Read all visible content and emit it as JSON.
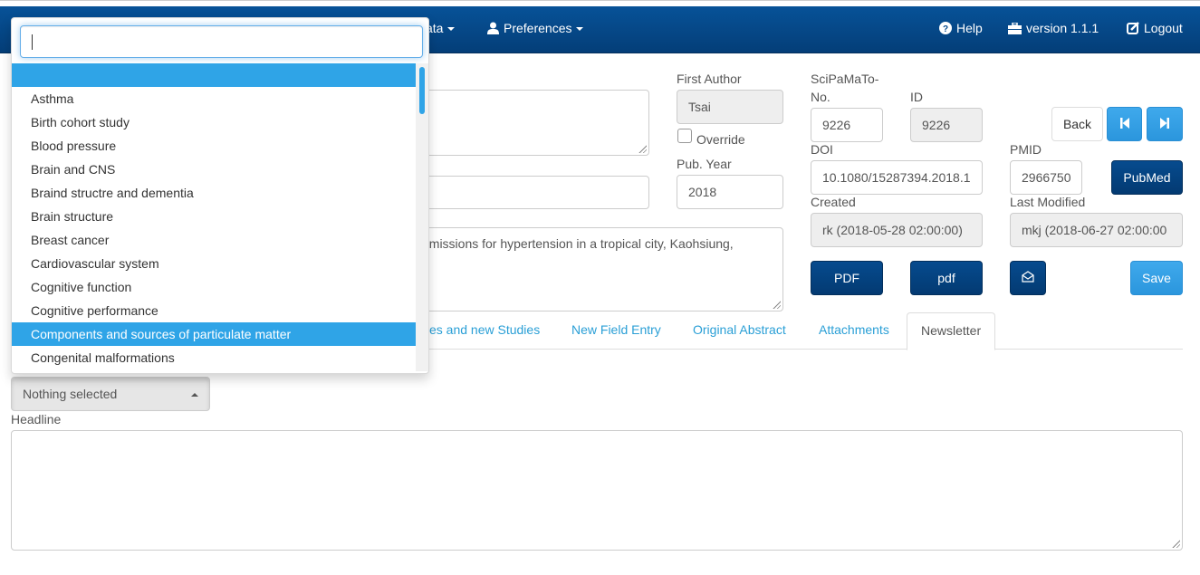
{
  "navbar": {
    "partial_menu": "ata",
    "preferences": "Preferences",
    "help": "Help",
    "version": "version 1.1.1",
    "logout": "Logout",
    "icons": {
      "preferences": "user-icon",
      "help": "question-circle-icon",
      "version": "briefcase-icon",
      "logout": "edit-square-icon"
    }
  },
  "form": {
    "first_author": {
      "label": "First Author",
      "value": "Tsai"
    },
    "override": {
      "label": "Override",
      "checked": false
    },
    "pub_year": {
      "label": "Pub. Year",
      "value": "2018"
    },
    "scipamato_no": {
      "label_line1": "SciPaMaTo-",
      "label_line2": "No.",
      "value": "9226"
    },
    "id": {
      "label": "ID",
      "value": "9226"
    },
    "doi": {
      "label": "DOI",
      "value": "10.1080/15287394.2018.1"
    },
    "pmid": {
      "label": "PMID",
      "value": "2966750"
    },
    "created": {
      "label": "Created",
      "value": "rk (2018-05-28 02:00:00)"
    },
    "last_modified": {
      "label": "Last Modified",
      "value": "mkj (2018-06-27 02:00:00"
    },
    "title_partial": "dmissions for hypertension in a tropical city, Kaohsiung,"
  },
  "buttons": {
    "back": "Back",
    "pubmed": "PubMed",
    "pdf_upper": "PDF",
    "pdf_lower": "pdf",
    "save": "Save",
    "prev_icon": "step-backward-icon",
    "next_icon": "step-forward-icon",
    "mail_icon": "envelope-open-icon"
  },
  "tabs": [
    {
      "label": "es and new Studies",
      "active": false
    },
    {
      "label": "New Field Entry",
      "active": false
    },
    {
      "label": "Original Abstract",
      "active": false
    },
    {
      "label": "Attachments",
      "active": false
    },
    {
      "label": "Newsletter",
      "active": true
    }
  ],
  "newsletter": {
    "select_value": "Nothing selected",
    "headline_label": "Headline",
    "headline_value": ""
  },
  "dropdown": {
    "search_value": "",
    "items": [
      {
        "label": "",
        "highlighted": true
      },
      {
        "label": "Asthma",
        "highlighted": false
      },
      {
        "label": "Birth cohort study",
        "highlighted": false
      },
      {
        "label": "Blood pressure",
        "highlighted": false
      },
      {
        "label": "Brain and CNS",
        "highlighted": false
      },
      {
        "label": "Braind structre and dementia",
        "highlighted": false
      },
      {
        "label": "Brain structure",
        "highlighted": false
      },
      {
        "label": "Breast cancer",
        "highlighted": false
      },
      {
        "label": "Cardiovascular system",
        "highlighted": false
      },
      {
        "label": "Cognitive function",
        "highlighted": false
      },
      {
        "label": "Cognitive performance",
        "highlighted": false
      },
      {
        "label": "Components and sources of particulate matter",
        "highlighted": true
      },
      {
        "label": "Congenital malformations",
        "highlighted": false
      }
    ]
  },
  "colors": {
    "navbar": "#064b8e",
    "accent": "#2fa4e7",
    "dark_button": "#043e78"
  }
}
